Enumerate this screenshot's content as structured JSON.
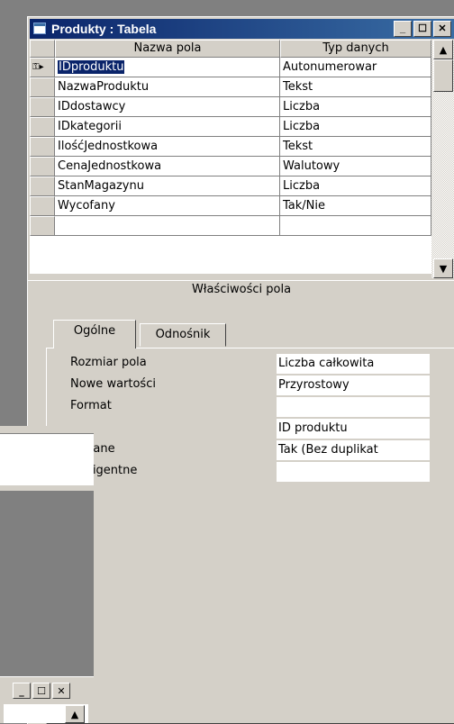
{
  "window": {
    "title": "Produkty : Tabela"
  },
  "grid": {
    "headers": [
      "Nazwa pola",
      "Typ danych"
    ],
    "rows": [
      {
        "name": "IDproduktu",
        "type": "Autonumerowar"
      },
      {
        "name": "NazwaProduktu",
        "type": "Tekst"
      },
      {
        "name": "IDdostawcy",
        "type": "Liczba"
      },
      {
        "name": "IDkategorii",
        "type": "Liczba"
      },
      {
        "name": "IlośćJednostkowa",
        "type": "Tekst"
      },
      {
        "name": "CenaJednostkowa",
        "type": "Walutowy"
      },
      {
        "name": "StanMagazynu",
        "type": "Liczba"
      },
      {
        "name": "Wycofany",
        "type": "Tak/Nie"
      },
      {
        "name": "",
        "type": ""
      }
    ]
  },
  "properties": {
    "section_title": "Właściwości pola",
    "tabs": [
      "Ogólne",
      "Odnośnik"
    ],
    "fields": [
      {
        "label": "Rozmiar pola",
        "value": "Liczba całkowita"
      },
      {
        "label": "Nowe wartości",
        "value": "Przyrostowy"
      },
      {
        "label": "Format",
        "value": ""
      },
      {
        "label": "",
        "value": "ID produktu"
      },
      {
        "label": "sowane",
        "value": "Tak (Bez duplikat"
      },
      {
        "label": "nteligentne",
        "value": ""
      }
    ]
  },
  "window_buttons": {
    "minimize": "_",
    "maximize": "☐",
    "close": "✕"
  },
  "scroll": {
    "up": "▲",
    "down": "▼"
  }
}
